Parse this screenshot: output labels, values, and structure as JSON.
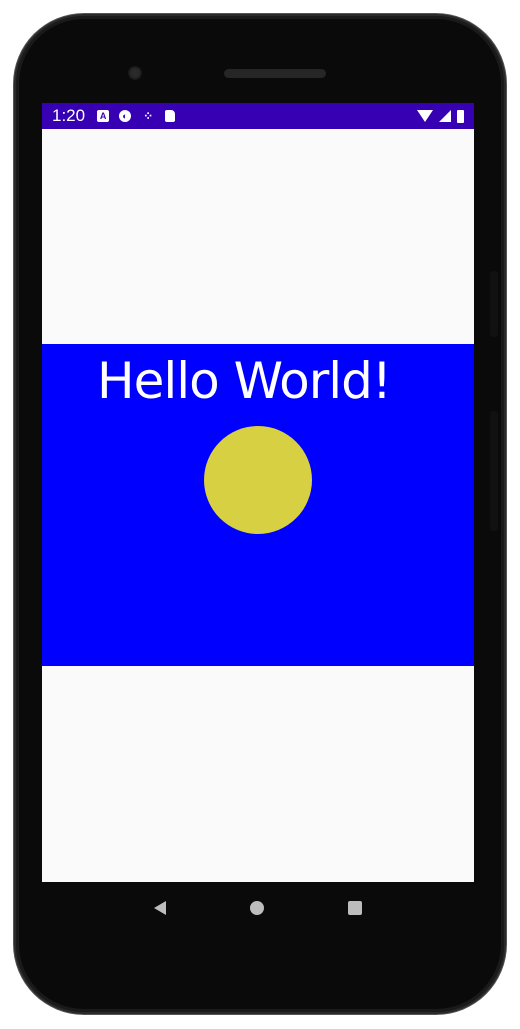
{
  "status_bar": {
    "time": "1:20",
    "notification_icons": [
      "a11y-icon",
      "vpn-key-icon",
      "network-icon",
      "sd-card-icon"
    ],
    "right_icons": [
      "wifi-icon",
      "signal-icon",
      "battery-icon"
    ],
    "background_color": "#3700b3"
  },
  "app": {
    "greeting": "Hello World!",
    "panel_color": "#0000fe",
    "circle_color": "#d6d042",
    "screen_background": "#fafafa"
  },
  "navigation": {
    "buttons": [
      "back",
      "home",
      "recents"
    ]
  }
}
